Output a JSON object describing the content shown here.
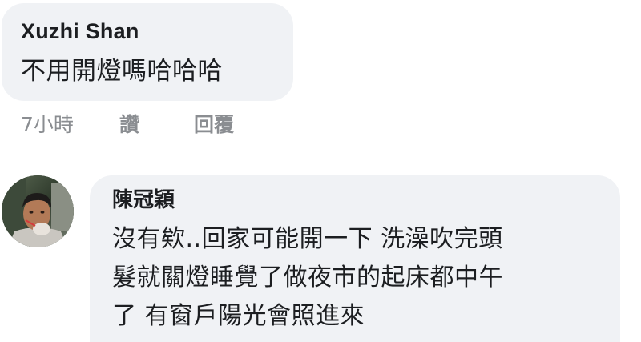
{
  "comments": [
    {
      "author": "Xuzhi Shan",
      "text": "不用開燈嗎哈哈哈",
      "actions": {
        "time": "7小時",
        "like": "讚",
        "reply": "回覆"
      }
    },
    {
      "author": "陳冠穎",
      "avatar_icon": "user-photo-avatar",
      "text_lines": [
        "沒有欸..回家可能開一下 洗澡吹完頭",
        "髮就關燈睡覺了做夜市的起床都中午",
        "了 有窗戶陽光會照進來"
      ]
    }
  ],
  "colors": {
    "bubble": "#f0f2f5",
    "text": "#1c1e21",
    "meta": "#8a8d91",
    "background": "#ffffff"
  }
}
